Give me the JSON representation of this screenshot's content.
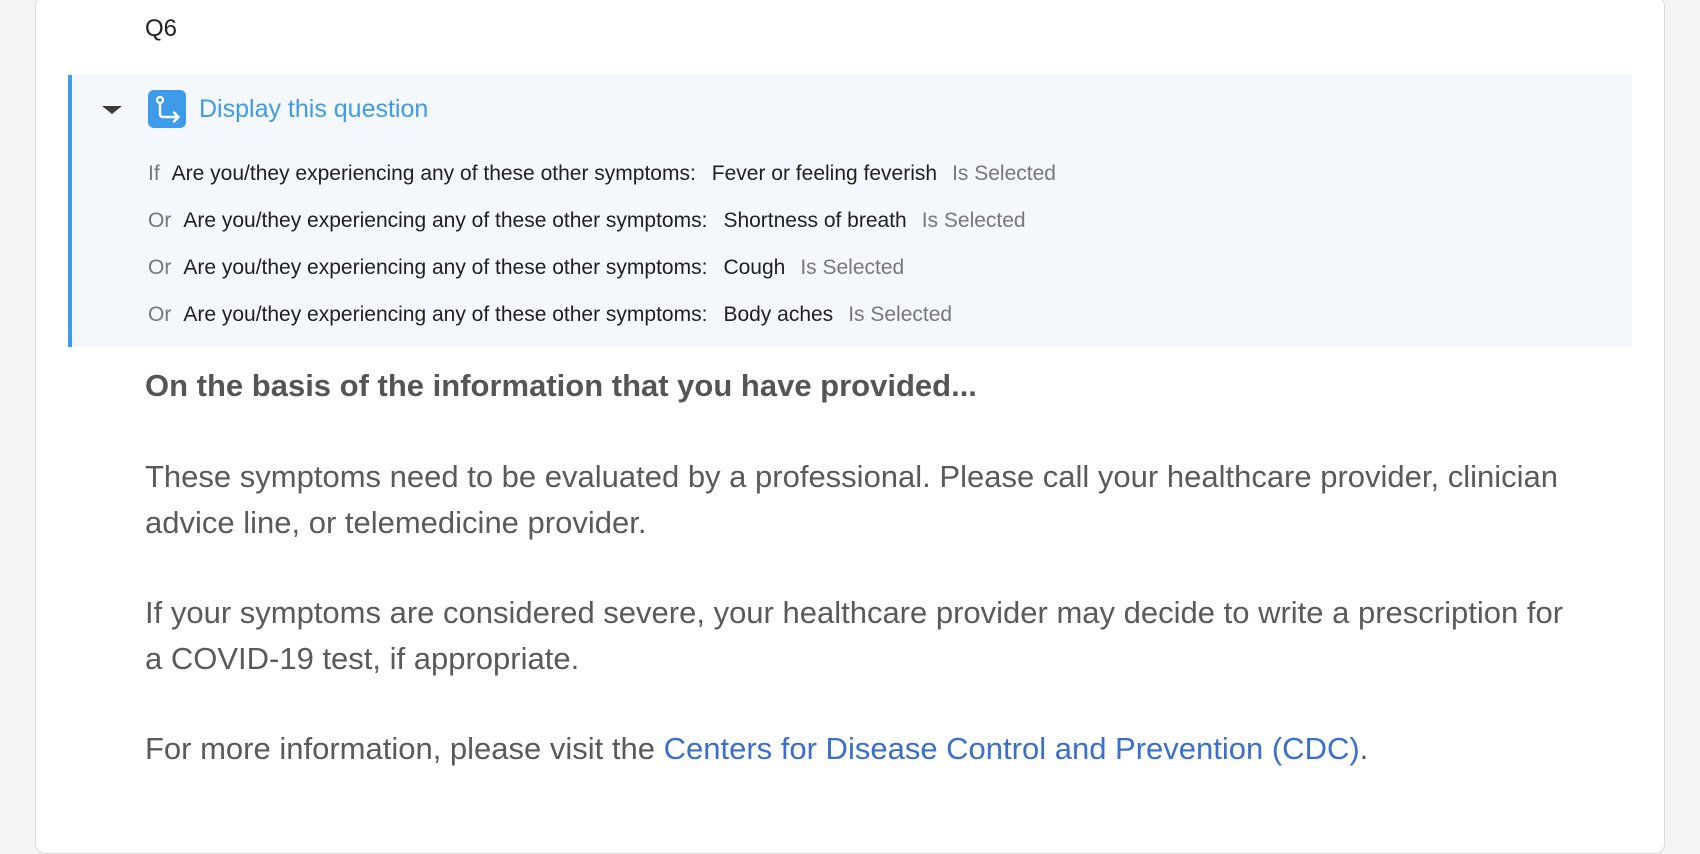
{
  "question": {
    "number": "Q6"
  },
  "display_logic": {
    "title": "Display this question",
    "conditions": [
      {
        "conjunction": "If",
        "question": "Are you/they experiencing any of these other symptoms:",
        "choice": "Fever or feeling feverish",
        "operator": "Is Selected"
      },
      {
        "conjunction": "Or",
        "question": "Are you/they experiencing any of these other symptoms:",
        "choice": "Shortness of breath",
        "operator": "Is Selected"
      },
      {
        "conjunction": "Or",
        "question": "Are you/they experiencing any of these other symptoms:",
        "choice": "Cough",
        "operator": "Is Selected"
      },
      {
        "conjunction": "Or",
        "question": "Are you/they experiencing any of these other symptoms:",
        "choice": "Body aches",
        "operator": "Is Selected"
      }
    ]
  },
  "content": {
    "heading": "On the basis of the information that you have provided...",
    "paragraph1": "These symptoms need to be evaluated by a professional. Please call your healthcare provider, clinician advice line, or telemedicine provider.",
    "paragraph2": "If your symptoms are considered severe, your healthcare provider may decide to write a prescription for a COVID-19 test, if appropriate.",
    "paragraph3_prefix": "For more information, please visit the ",
    "paragraph3_link": "Centers for Disease Control and Prevention (CDC)",
    "paragraph3_suffix": "."
  },
  "colors": {
    "accent": "#3d9be9",
    "link": "#3a6fcf",
    "logic_background": "#f4f7fc"
  },
  "icons": {
    "collapse": "caret-down-icon",
    "logic": "display-logic-icon"
  }
}
